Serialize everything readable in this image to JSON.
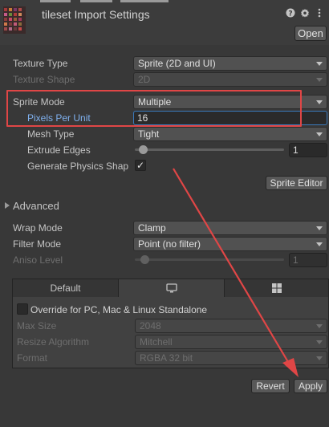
{
  "header": {
    "title": "tileset Import Settings",
    "open_label": "Open",
    "icons": [
      "help-icon",
      "settings-icon",
      "more-icon"
    ]
  },
  "texture_type": {
    "label": "Texture Type",
    "value": "Sprite (2D and UI)"
  },
  "texture_shape": {
    "label": "Texture Shape",
    "value": "2D"
  },
  "sprite_mode": {
    "label": "Sprite Mode",
    "value": "Multiple"
  },
  "pixels_per_unit": {
    "label": "Pixels Per Unit",
    "value": "16"
  },
  "mesh_type": {
    "label": "Mesh Type",
    "value": "Tight"
  },
  "extrude_edges": {
    "label": "Extrude Edges",
    "value": "1"
  },
  "generate_physics_shape": {
    "label": "Generate Physics Shap",
    "checked": true,
    "check_glyph": "✓"
  },
  "sprite_editor_label": "Sprite Editor",
  "advanced_label": "Advanced",
  "wrap_mode": {
    "label": "Wrap Mode",
    "value": "Clamp"
  },
  "filter_mode": {
    "label": "Filter Mode",
    "value": "Point (no filter)"
  },
  "aniso_level": {
    "label": "Aniso Level",
    "value": "1"
  },
  "platform": {
    "tabs": [
      {
        "label": "Default",
        "icon": "default-tab"
      },
      {
        "label": "",
        "icon": "monitor-icon"
      },
      {
        "label": "",
        "icon": "windows-icon"
      }
    ],
    "override_label": "Override for PC, Mac & Linux Standalone",
    "max_size": {
      "label": "Max Size",
      "value": "2048"
    },
    "resize_algorithm": {
      "label": "Resize Algorithm",
      "value": "Mitchell"
    },
    "format": {
      "label": "Format",
      "value": "RGBA 32 bit"
    }
  },
  "footer": {
    "revert_label": "Revert",
    "apply_label": "Apply"
  },
  "colors": {
    "background": "#383838",
    "annotation": "#e04646",
    "focus": "#3a79bb",
    "label_highlight": "#7fb0ee"
  }
}
